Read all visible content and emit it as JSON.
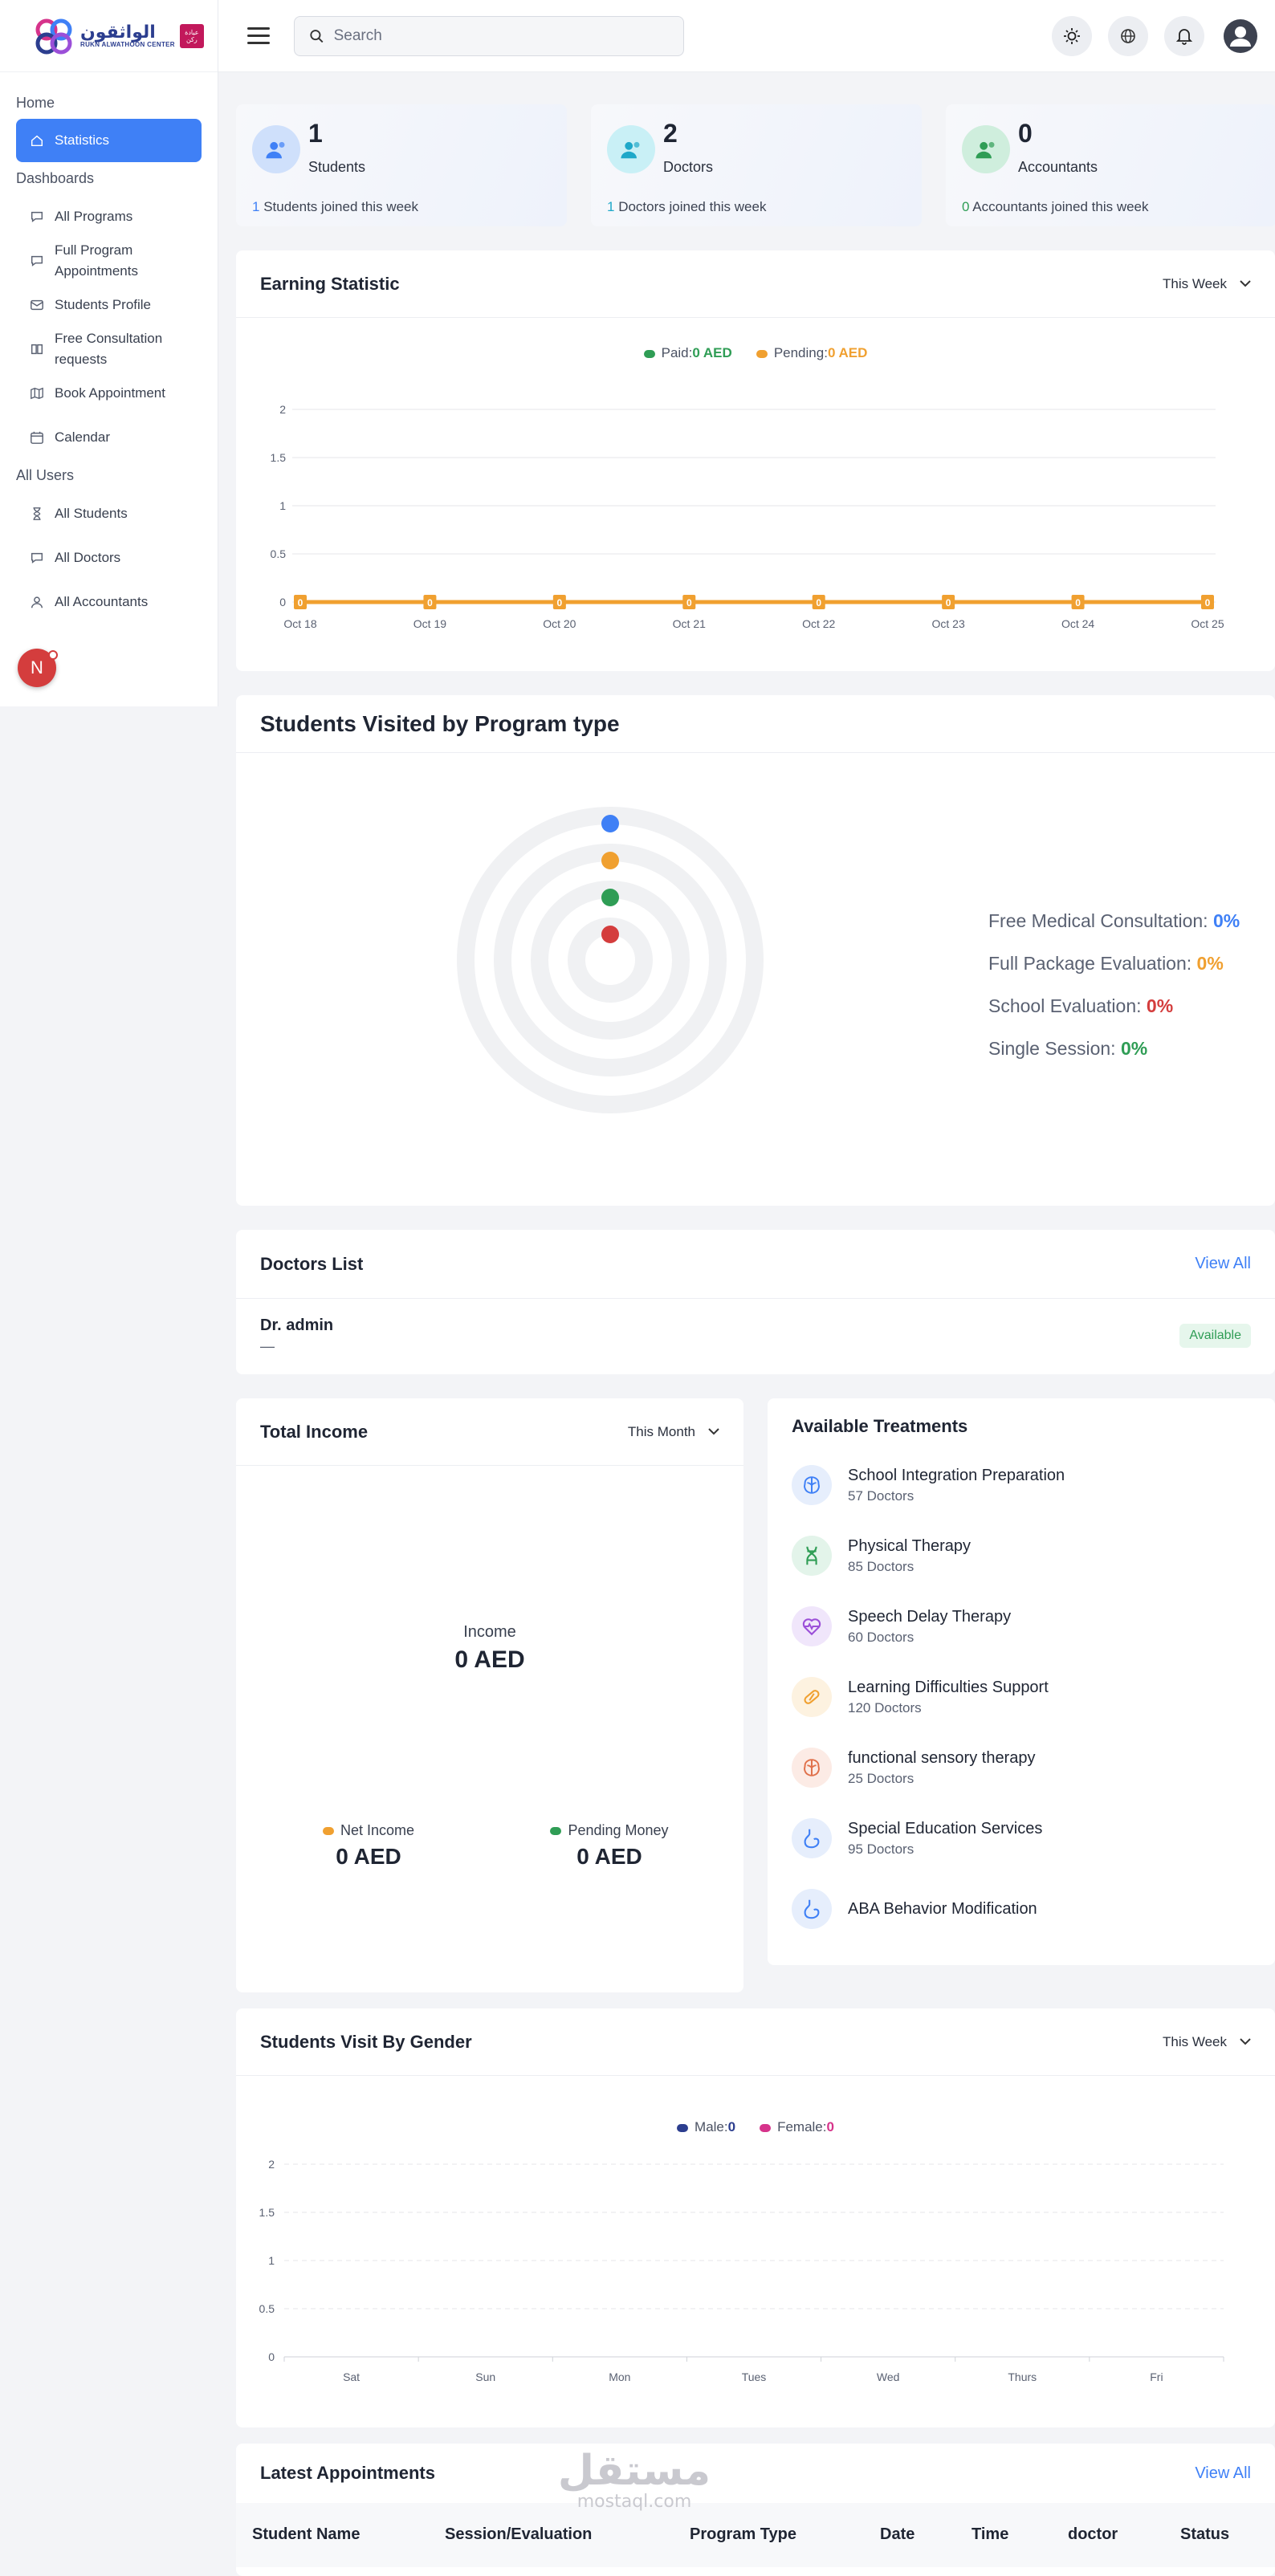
{
  "brand": {
    "name_ar": "الواثقون",
    "name_en": "RUKN ALWATHOON CENTER",
    "tag": "عيادة ركن"
  },
  "search": {
    "placeholder": "Search"
  },
  "sidebar": {
    "sections": [
      {
        "title": "Home",
        "items": [
          {
            "label": "Statistics",
            "icon": "home-icon",
            "active": true
          }
        ]
      },
      {
        "title": "Dashboards",
        "items": [
          {
            "label": "All Programs",
            "icon": "chat-icon"
          },
          {
            "label": "Full Program Appointments",
            "icon": "chat-icon"
          },
          {
            "label": "Students Profile",
            "icon": "mail-icon"
          },
          {
            "label": "Free Consultation requests",
            "icon": "book-icon"
          },
          {
            "label": "Book Appointment",
            "icon": "map-icon"
          },
          {
            "label": "Calendar",
            "icon": "calendar-icon"
          }
        ]
      },
      {
        "title": "All Users",
        "items": [
          {
            "label": "All Students",
            "icon": "hourglass-icon"
          },
          {
            "label": "All Doctors",
            "icon": "chat-icon"
          },
          {
            "label": "All Accountants",
            "icon": "user-icon"
          }
        ]
      }
    ],
    "fab_letter": "N"
  },
  "stats": [
    {
      "count": "1",
      "label": "Students",
      "sub_count": "1",
      "sub_text": "Students joined this week",
      "color": "#3f80f6",
      "bg": "#cfe0fb"
    },
    {
      "count": "2",
      "label": "Doctors",
      "sub_count": "1",
      "sub_text": "Doctors joined this week",
      "color": "#1fa8c9",
      "bg": "#c9f0f6"
    },
    {
      "count": "0",
      "label": "Accountants",
      "sub_count": "0",
      "sub_text": "Accountants joined this week",
      "color": "#2f9d55",
      "bg": "#cfeedd"
    }
  ],
  "earning": {
    "title": "Earning Statistic",
    "period": "This Week",
    "legend": [
      {
        "label": "Paid:",
        "value": "0 AED",
        "color": "#2f9d55"
      },
      {
        "label": "Pending:",
        "value": "0 AED",
        "color": "#f0a030"
      }
    ]
  },
  "program_type": {
    "title": "Students Visited by Program type",
    "items": [
      {
        "label": "Free Medical Consultation:",
        "value": "0%",
        "color": "#3f80f6"
      },
      {
        "label": "Full Package Evaluation:",
        "value": "0%",
        "color": "#f0a030"
      },
      {
        "label": "School Evaluation:",
        "value": "0%",
        "color": "#d43d3d"
      },
      {
        "label": "Single Session:",
        "value": "0%",
        "color": "#2f9d55"
      }
    ]
  },
  "doctors": {
    "title": "Doctors List",
    "view_all": "View All",
    "rows": [
      {
        "name": "Dr. admin",
        "sub": "—",
        "status": "Available"
      }
    ]
  },
  "income": {
    "title": "Total Income",
    "period": "This Month",
    "income_label": "Income",
    "income_value": "0 AED",
    "net_label": "Net Income",
    "net_value": "0 AED",
    "pending_label": "Pending Money",
    "pending_value": "0 AED"
  },
  "treatments": {
    "title": "Available Treatments",
    "items": [
      {
        "name": "School Integration Preparation",
        "sub": "57 Doctors",
        "icon": "brain-icon",
        "color": "#3f80f6",
        "bg": "#e6eefc"
      },
      {
        "name": "Physical Therapy",
        "sub": "85 Doctors",
        "icon": "dna-icon",
        "color": "#2f9d55",
        "bg": "#e3f4ea"
      },
      {
        "name": "Speech Delay Therapy",
        "sub": "60 Doctors",
        "icon": "heart-pulse-icon",
        "color": "#9b4fd8",
        "bg": "#f0e6fb"
      },
      {
        "name": "Learning Difficulties Support",
        "sub": "120 Doctors",
        "icon": "pill-icon",
        "color": "#f0a030",
        "bg": "#fdf2e0"
      },
      {
        "name": "functional sensory therapy",
        "sub": "25 Doctors",
        "icon": "brain-icon",
        "color": "#e0704a",
        "bg": "#fcebe5"
      },
      {
        "name": "Special Education Services",
        "sub": "95 Doctors",
        "icon": "stomach-icon",
        "color": "#3f80f6",
        "bg": "#e6eefc"
      },
      {
        "name": "ABA Behavior Modification",
        "sub": "",
        "icon": "stomach-icon",
        "color": "#3f80f6",
        "bg": "#e6eefc"
      }
    ]
  },
  "gender": {
    "title": "Students Visit By Gender",
    "period": "This Week",
    "legend": [
      {
        "label": "Male:",
        "value": "0",
        "color": "#2c3e8f"
      },
      {
        "label": "Female:",
        "value": "0",
        "color": "#d6338b"
      }
    ]
  },
  "appointments": {
    "title": "Latest Appointments",
    "view_all": "View All",
    "columns": [
      "Student Name",
      "Session/Evaluation",
      "Program Type",
      "Date",
      "Time",
      "doctor",
      "Status"
    ]
  },
  "watermark": {
    "ar": "مستقل",
    "en": "mostaql.com"
  },
  "chart_data": [
    {
      "type": "line",
      "categories": [
        "Oct 18",
        "Oct 19",
        "Oct 20",
        "Oct 21",
        "Oct 22",
        "Oct 23",
        "Oct 24",
        "Oct 25"
      ],
      "series": [
        {
          "name": "Paid",
          "values": [
            0,
            0,
            0,
            0,
            0,
            0,
            0,
            0
          ]
        },
        {
          "name": "Pending",
          "values": [
            0,
            0,
            0,
            0,
            0,
            0,
            0,
            0
          ]
        }
      ],
      "data_labels": [
        "0",
        "0",
        "0",
        "0",
        "0",
        "0",
        "0",
        "0"
      ],
      "yticks": [
        "2",
        "1.5",
        "1",
        "0.5",
        "0"
      ],
      "ylim": [
        0,
        2
      ],
      "grid": true,
      "legend": "top-center"
    },
    {
      "type": "pie",
      "categories": [
        "Free Medical Consultation",
        "Full Package Evaluation",
        "School Evaluation",
        "Single Session"
      ],
      "values": [
        0,
        0,
        0,
        0
      ]
    },
    {
      "type": "bar",
      "categories": [
        "Sat",
        "Sun",
        "Mon",
        "Tues",
        "Wed",
        "Thurs",
        "Fri"
      ],
      "series": [
        {
          "name": "Male",
          "values": [
            0,
            0,
            0,
            0,
            0,
            0,
            0
          ]
        },
        {
          "name": "Female",
          "values": [
            0,
            0,
            0,
            0,
            0,
            0,
            0
          ]
        }
      ],
      "yticks": [
        "2",
        "1.5",
        "1",
        "0.5",
        "0"
      ],
      "ylim": [
        0,
        2
      ],
      "grid": true,
      "legend": "top-center"
    }
  ]
}
